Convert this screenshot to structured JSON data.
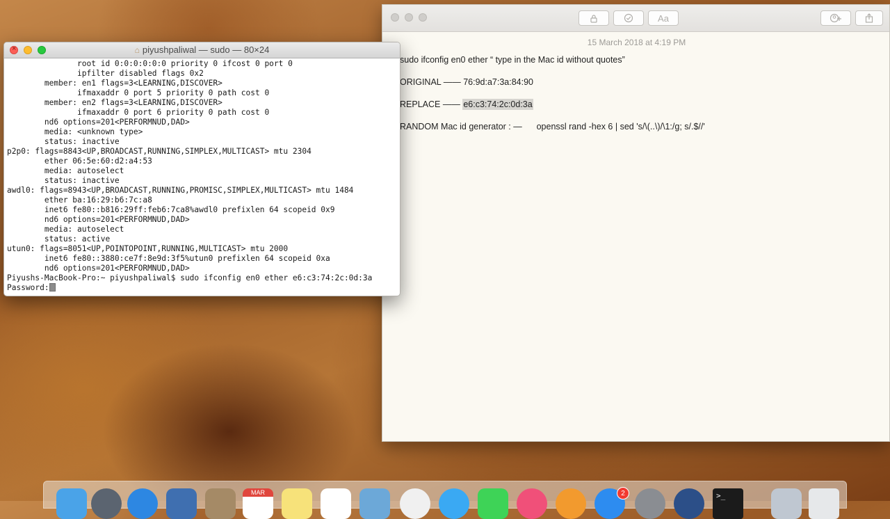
{
  "notes": {
    "date": "15 March 2018 at 4:19 PM",
    "toolbar": {
      "lock_icon": "lock-icon",
      "checklist_icon": "checkmark-circle-icon",
      "format_label": "Aa",
      "add_people_icon": "add-people-icon",
      "share_icon": "share-icon"
    },
    "lines": [
      {
        "text": "sudo ifconfig en0 ether “ type in the Mac id without quotes”"
      },
      {
        "text": "ORIGINAL —— 76:9d:a7:3a:84:90"
      },
      {
        "prefix": "REPLACE —— ",
        "highlight": "e6:c3:74:2c:0d:3a"
      },
      {
        "text": "RANDOM Mac id generator : —      openssl rand -hex 6 | sed 's/\\(..\\)/\\1:/g; s/.$//'"
      }
    ]
  },
  "terminal": {
    "title": "piyushpaliwal — sudo — 80×24",
    "lines": [
      "               root id 0:0:0:0:0:0 priority 0 ifcost 0 port 0",
      "               ipfilter disabled flags 0x2",
      "        member: en1 flags=3<LEARNING,DISCOVER>",
      "               ifmaxaddr 0 port 5 priority 0 path cost 0",
      "        member: en2 flags=3<LEARNING,DISCOVER>",
      "               ifmaxaddr 0 port 6 priority 0 path cost 0",
      "        nd6 options=201<PERFORMNUD,DAD>",
      "        media: <unknown type>",
      "        status: inactive",
      "p2p0: flags=8843<UP,BROADCAST,RUNNING,SIMPLEX,MULTICAST> mtu 2304",
      "        ether 06:5e:60:d2:a4:53",
      "        media: autoselect",
      "        status: inactive",
      "awdl0: flags=8943<UP,BROADCAST,RUNNING,PROMISC,SIMPLEX,MULTICAST> mtu 1484",
      "        ether ba:16:29:b6:7c:a8",
      "        inet6 fe80::b816:29ff:feb6:7ca8%awdl0 prefixlen 64 scopeid 0x9",
      "        nd6 options=201<PERFORMNUD,DAD>",
      "        media: autoselect",
      "        status: active",
      "utun0: flags=8051<UP,POINTOPOINT,RUNNING,MULTICAST> mtu 2000",
      "        inet6 fe80::3880:ce7f:8e9d:3f5%utun0 prefixlen 64 scopeid 0xa",
      "        nd6 options=201<PERFORMNUD,DAD>",
      "Piyushs-MacBook-Pro:~ piyushpaliwal$ sudo ifconfig en0 ether e6:c3:74:2c:0d:3a"
    ],
    "password_prompt": "Password:"
  },
  "dock": {
    "calendar_month": "MAR",
    "app_store_badge": "2",
    "terminal_glyph": ">_",
    "icons": [
      "finder-icon",
      "launchpad-icon",
      "safari-icon",
      "preview-icon",
      "contacts-icon",
      "calendar-icon",
      "notes-icon",
      "reminders-icon",
      "photo-browser-icon",
      "photos-icon",
      "messages-icon",
      "facetime-icon",
      "itunes-icon",
      "ibooks-icon",
      "app-store-icon",
      "system-preferences-icon",
      "quicktime-icon",
      "terminal-icon",
      "downloads-icon",
      "trash-icon"
    ],
    "colors": {
      "finder": "#4aa3e8",
      "launchpad": "#5b6470",
      "safari": "#2d87e2",
      "preview": "#3f6fb0",
      "contacts": "#a58a66",
      "calendar": "#ffffff",
      "notes": "#f7e27a",
      "reminders": "#ffffff",
      "photo_browser": "#6ca8d8",
      "photos": "#f0f0f0",
      "messages": "#3aa9f3",
      "facetime": "#3ed357",
      "itunes": "#f05079",
      "ibooks": "#f29a2e",
      "app_store": "#2d8cf0",
      "system_preferences": "#8a8d92",
      "quicktime": "#2c4f88",
      "terminal": "#1b1b1b",
      "downloads": "#bfc7d1",
      "trash": "#e6e8ea"
    }
  }
}
